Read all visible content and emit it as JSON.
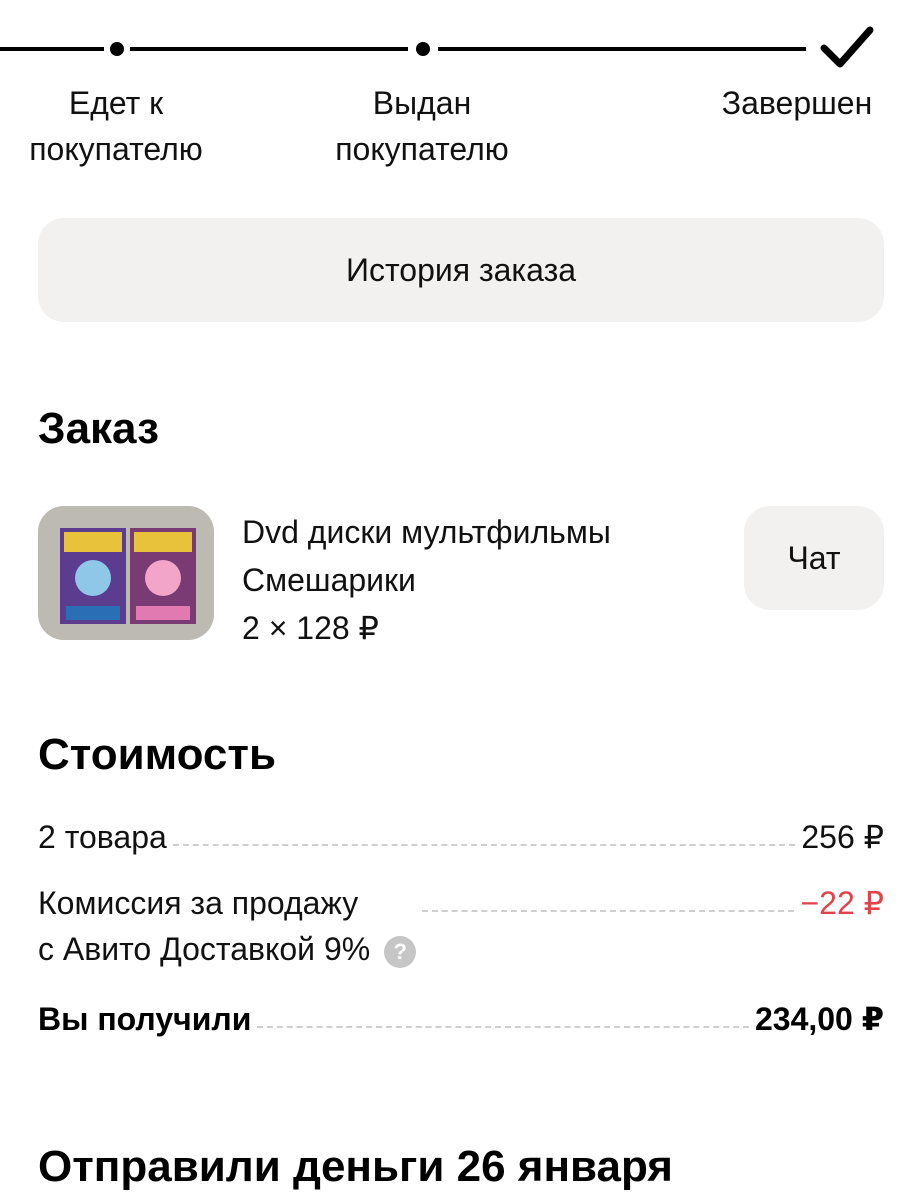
{
  "progress": {
    "steps": [
      {
        "line1": "Едет к",
        "line2": "покупателю"
      },
      {
        "line1": "Выдан",
        "line2": "покупателю"
      },
      {
        "line1": "Завершен",
        "line2": ""
      }
    ],
    "completed_step_icon": "check-icon"
  },
  "history_button": "История заказа",
  "order": {
    "title": "Заказ",
    "product_name": "Dvd диски мультфильмы Смешарики",
    "product_price": "2 × 128 ₽",
    "chat_button": "Чат"
  },
  "cost": {
    "title": "Стоимость",
    "rows": [
      {
        "label": "2 товара",
        "value": "256 ₽"
      },
      {
        "label_line1": "Комиссия за продажу",
        "label_line2": "с Авито Доставкой 9%",
        "value": "−22 ₽"
      }
    ],
    "total_label": "Вы получили",
    "total_value": "234,00 ₽",
    "help_icon": "question-icon"
  },
  "payout_title": "Отправили деньги 26 января",
  "colors": {
    "negative": "#e2434b",
    "button_bg": "#f2f1f0",
    "dashed": "#cfcfcf"
  }
}
